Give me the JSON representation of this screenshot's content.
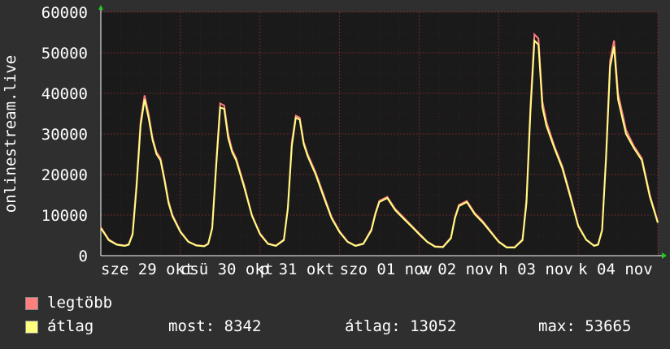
{
  "colors": {
    "background": "#2f2f2f",
    "plot_background": "#1a1a1a",
    "grid": "#b03030",
    "text": "#ffffff",
    "max_series": "#ff7f7f",
    "avg_series": "#ffff80",
    "arrow": "#22cc22"
  },
  "legend": {
    "max_label": "legtöbb",
    "avg_label": "átlag",
    "now_stat": "most: 8342",
    "avg_stat": "átlag: 13052",
    "max_stat": "max: 53665"
  },
  "chart_data": {
    "type": "line",
    "ylabel": "onlinestream.live",
    "ylim": [
      0,
      60000
    ],
    "yticks": [
      "0",
      "10000",
      "20000",
      "30000",
      "40000",
      "50000",
      "60000"
    ],
    "xlim": [
      0,
      7
    ],
    "xtick_labels": [
      "sze 29 okt",
      "csü 30 okt",
      "p 31 okt",
      "szo 01 nov",
      "v 02 nov",
      "h 03 nov",
      "k 04 nov"
    ],
    "grid": true,
    "series": [
      {
        "name": "legtöbb",
        "x": [
          0,
          0.1,
          0.2,
          0.3,
          0.35,
          0.4,
          0.45,
          0.5,
          0.55,
          0.6,
          0.65,
          0.7,
          0.75,
          0.8,
          0.85,
          0.9,
          1.0,
          1.1,
          1.2,
          1.3,
          1.35,
          1.4,
          1.45,
          1.5,
          1.55,
          1.6,
          1.65,
          1.7,
          1.8,
          1.9,
          2.0,
          2.1,
          2.2,
          2.3,
          2.35,
          2.4,
          2.45,
          2.5,
          2.55,
          2.6,
          2.7,
          2.8,
          2.9,
          3.0,
          3.1,
          3.2,
          3.3,
          3.4,
          3.45,
          3.5,
          3.6,
          3.7,
          3.8,
          3.9,
          4.0,
          4.1,
          4.2,
          4.3,
          4.4,
          4.45,
          4.5,
          4.6,
          4.7,
          4.8,
          4.9,
          5.0,
          5.1,
          5.2,
          5.3,
          5.35,
          5.4,
          5.45,
          5.5,
          5.55,
          5.6,
          5.7,
          5.8,
          5.9,
          6.0,
          6.1,
          6.2,
          6.25,
          6.3,
          6.35,
          6.4,
          6.45,
          6.5,
          6.6,
          6.7,
          6.8,
          6.9,
          7.0
        ],
        "values": [
          7000,
          4000,
          2800,
          2500,
          2800,
          5500,
          18000,
          33000,
          39500,
          35000,
          29000,
          25500,
          24000,
          19000,
          13500,
          10000,
          6000,
          3500,
          2600,
          2400,
          3000,
          7000,
          23000,
          37500,
          37000,
          30000,
          26000,
          24000,
          17500,
          10000,
          5500,
          3000,
          2500,
          4000,
          12000,
          28000,
          34500,
          34000,
          28000,
          25000,
          20500,
          15000,
          9500,
          6000,
          3500,
          2500,
          3000,
          6500,
          10500,
          13500,
          14500,
          11500,
          9500,
          7500,
          5500,
          3500,
          2300,
          2200,
          4500,
          9500,
          12500,
          13500,
          10500,
          8500,
          6000,
          3500,
          2100,
          2100,
          4000,
          14000,
          37000,
          54500,
          53500,
          38000,
          33000,
          27000,
          22000,
          15000,
          7500,
          4000,
          2500,
          2800,
          6500,
          25000,
          48000,
          53000,
          40000,
          31000,
          27000,
          24000,
          15000,
          8342
        ]
      },
      {
        "name": "átlag",
        "x": [
          0,
          0.1,
          0.2,
          0.3,
          0.35,
          0.4,
          0.45,
          0.5,
          0.55,
          0.6,
          0.65,
          0.7,
          0.75,
          0.8,
          0.85,
          0.9,
          1.0,
          1.1,
          1.2,
          1.3,
          1.35,
          1.4,
          1.45,
          1.5,
          1.55,
          1.6,
          1.65,
          1.7,
          1.8,
          1.9,
          2.0,
          2.1,
          2.2,
          2.3,
          2.35,
          2.4,
          2.45,
          2.5,
          2.55,
          2.6,
          2.7,
          2.8,
          2.9,
          3.0,
          3.1,
          3.2,
          3.3,
          3.4,
          3.45,
          3.5,
          3.6,
          3.7,
          3.8,
          3.9,
          4.0,
          4.1,
          4.2,
          4.3,
          4.4,
          4.45,
          4.5,
          4.6,
          4.7,
          4.8,
          4.9,
          5.0,
          5.1,
          5.2,
          5.3,
          5.35,
          5.4,
          5.45,
          5.5,
          5.55,
          5.6,
          5.7,
          5.8,
          5.9,
          6.0,
          6.1,
          6.2,
          6.25,
          6.3,
          6.35,
          6.4,
          6.45,
          6.5,
          6.6,
          6.7,
          6.8,
          6.9,
          7.0
        ],
        "values": [
          6800,
          3800,
          2700,
          2400,
          2700,
          5200,
          17000,
          32000,
          38500,
          34000,
          28500,
          25000,
          23500,
          18500,
          13000,
          9700,
          5800,
          3400,
          2500,
          2300,
          2900,
          6700,
          22000,
          36500,
          36200,
          29000,
          25500,
          23500,
          17000,
          9800,
          5300,
          2900,
          2400,
          3800,
          11500,
          27000,
          34000,
          33500,
          27500,
          24500,
          20000,
          14500,
          9200,
          5800,
          3400,
          2400,
          2900,
          6200,
          10200,
          13200,
          14200,
          11200,
          9200,
          7300,
          5300,
          3400,
          2200,
          2100,
          4300,
          9200,
          12200,
          13200,
          10200,
          8200,
          5800,
          3400,
          2000,
          2000,
          3800,
          13000,
          35500,
          53000,
          52000,
          36500,
          32000,
          26500,
          21500,
          14500,
          7300,
          3900,
          2400,
          2700,
          6200,
          24000,
          46500,
          51500,
          38500,
          30000,
          26500,
          23500,
          14500,
          8100
        ]
      }
    ]
  }
}
